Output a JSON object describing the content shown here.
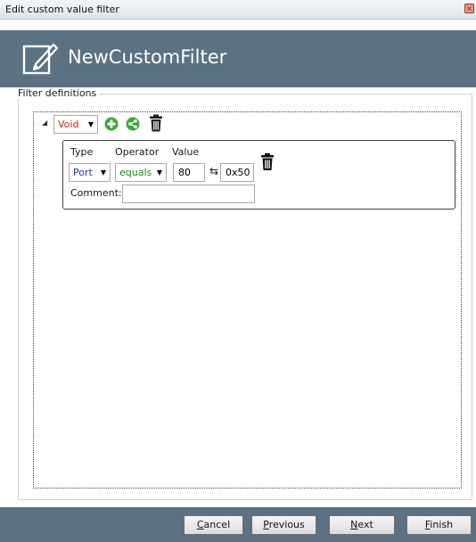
{
  "window": {
    "title": "Edit custom value filter",
    "close_glyph": "×"
  },
  "header": {
    "title": "NewCustomFilter",
    "icon": "edit-document-icon"
  },
  "filter_definitions": {
    "legend": "Filter definitions",
    "group": {
      "operator": "Void",
      "operator_color": "#d42020",
      "actions": [
        "add-icon",
        "share-icon",
        "trash-icon"
      ]
    },
    "condition": {
      "type_label": "Type",
      "operator_label": "Operator",
      "value_label": "Value",
      "type_value": "Port",
      "type_color": "#2233cc",
      "operator_value": "equals",
      "operator_color": "#1d8a1d",
      "value_decimal": "80",
      "value_hex": "0x50",
      "swap_glyph": "⇆",
      "comment_label": "Comment:",
      "comment_value": ""
    }
  },
  "footer": {
    "buttons": [
      {
        "access_key": "C",
        "rest": "ancel"
      },
      {
        "access_key": "P",
        "rest": "revious"
      },
      {
        "access_key": "N",
        "rest": "ext"
      },
      {
        "access_key": "F",
        "rest": "inish"
      }
    ]
  },
  "colors": {
    "header_bg": "#5a7281",
    "add_icon": "#3fa53f"
  }
}
